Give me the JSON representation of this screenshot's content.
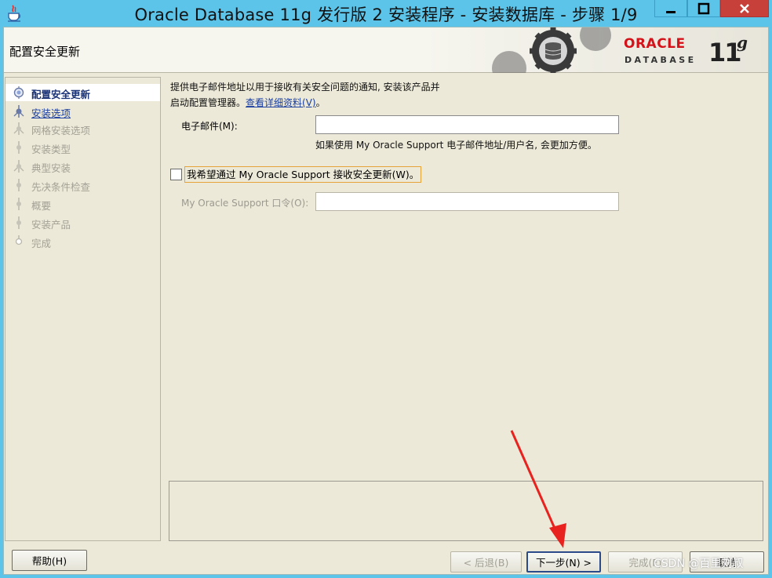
{
  "window": {
    "title": "Oracle Database 11g 发行版 2 安装程序 - 安装数据库 - 步骤 1/9"
  },
  "header": {
    "title": "配置安全更新",
    "logo_oracle": "ORACLE",
    "logo_database": "DATABASE",
    "logo_version": "11",
    "logo_suffix": "g"
  },
  "steps": [
    {
      "label": "配置安全更新",
      "state": "current"
    },
    {
      "label": "安装选项",
      "state": "link"
    },
    {
      "label": "网格安装选项",
      "state": "disabled"
    },
    {
      "label": "安装类型",
      "state": "disabled"
    },
    {
      "label": "典型安装",
      "state": "disabled"
    },
    {
      "label": "先决条件检查",
      "state": "disabled"
    },
    {
      "label": "概要",
      "state": "disabled"
    },
    {
      "label": "安装产品",
      "state": "disabled"
    },
    {
      "label": "完成",
      "state": "disabled"
    }
  ],
  "content": {
    "intro_line1": "提供电子邮件地址以用于接收有关安全问题的通知, 安装该产品并",
    "intro_line2_prefix": "启动配置管理器。",
    "intro_link": "查看详细资料(V)",
    "intro_line2_suffix": "。",
    "email_label": "电子邮件(M):",
    "email_value": "",
    "email_hint": "如果使用 My Oracle Support 电子邮件地址/用户名, 会更加方便。",
    "checkbox_label": "我希望通过 My Oracle Support 接收安全更新(W)。",
    "checkbox_checked": false,
    "password_label": "My Oracle Support 口令(O):",
    "password_value": ""
  },
  "buttons": {
    "help": "帮助(H)",
    "back": "< 后退(B)",
    "next": "下一步(N) >",
    "finish": "完成(F)",
    "cancel": "取消"
  },
  "watermark": "CSDN @百里刘叔",
  "colors": {
    "titlebar": "#5cc4e8",
    "panel": "#ece9d8",
    "close_button": "#c7403a",
    "oracle_red": "#d3121a",
    "link": "#1a3ea0",
    "annotation_arrow": "#e8231f"
  }
}
